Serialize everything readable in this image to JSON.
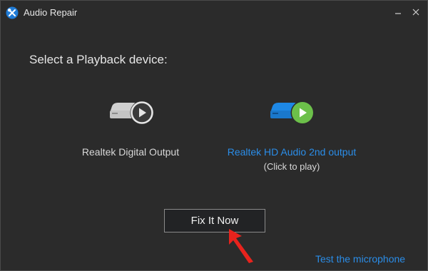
{
  "window": {
    "title": "Audio Repair",
    "app_icon": "wrench-screwdriver-icon",
    "controls": {
      "minimize_icon": "minimize-icon",
      "close_icon": "close-icon"
    }
  },
  "main": {
    "prompt": "Select a Playback device:",
    "devices": [
      {
        "name": "Realtek Digital Output",
        "icon": "speaker-device-play-icon",
        "selected": false,
        "color": "#c9c9c9",
        "play_color": "#3a3a3a"
      },
      {
        "name": "Realtek HD Audio 2nd output",
        "hint": "(Click to play)",
        "icon": "speaker-device-play-icon",
        "selected": true,
        "color": "#1e88e5",
        "play_color": "#6cc04a"
      }
    ],
    "fix_button": "Fix It Now",
    "test_link": "Test the microphone"
  },
  "colors": {
    "background": "#2b2b2b",
    "accent_blue": "#2b8de8",
    "play_green": "#6cc04a",
    "annotation_arrow": "#e8231d"
  }
}
